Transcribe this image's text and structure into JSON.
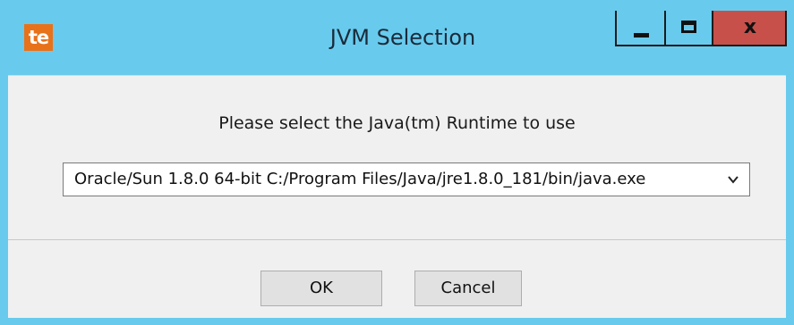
{
  "window": {
    "title": "JVM Selection",
    "app_icon_text": "te",
    "colors": {
      "titlebar": "#68cbee",
      "close_button": "#c7504b",
      "app_icon": "#e8721a",
      "client_background": "#f0f0f0"
    },
    "controls": {
      "minimize_icon": "minimize-icon",
      "maximize_icon": "maximize-icon",
      "close_label": "x"
    }
  },
  "dialog": {
    "prompt": "Please select the Java(tm) Runtime to use",
    "jvm_select": {
      "selected_value": "Oracle/Sun 1.8.0 64-bit C:/Program Files/Java/jre1.8.0_181/bin/java.exe"
    },
    "buttons": {
      "ok_label": "OK",
      "cancel_label": "Cancel"
    }
  }
}
